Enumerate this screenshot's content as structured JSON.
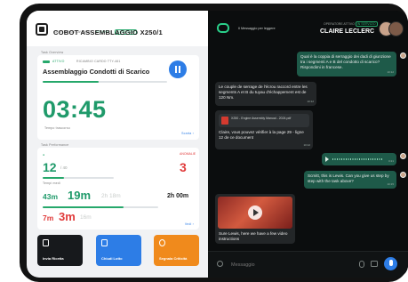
{
  "left": {
    "header": {
      "station_label": "CENTRO DI LAVORO",
      "station_status": "ATTIVO",
      "station_badge": "IN SERVIZIO",
      "title": "COBOT ASSEMBLAGGIO X250/1"
    },
    "task": {
      "section_label": "Task Overview",
      "status": "ATTIVO",
      "code": "RICAMBIO CARDO TTY-461",
      "name": "Assemblaggio Condotti di Scarico",
      "timer": "03:45",
      "timer_caption": "Tempo trascorso",
      "progress": 0.45,
      "footer_link": "Scarta ›"
    },
    "performance": {
      "section_label": "Task Performance",
      "count_value": "12",
      "count_target": "/ 40",
      "count_caption": "Pezzi completati",
      "alert_label": "ANOMALIE",
      "alert_value": "3",
      "times_caption": "Tempi medi",
      "t_min": "43m",
      "t_main": "19m",
      "t_ghost": "2h 18m",
      "t_right": "2h 00m",
      "t_bottom_small": "7m",
      "t_bottom_main": "3m",
      "t_bottom_ghost": "16m",
      "footer_link": "Vedi ›"
    },
    "actions": [
      {
        "label": "Invia Ricetta",
        "color": "#17191c"
      },
      {
        "label": "Chiudi Lotto",
        "color": "#2d7de6"
      },
      {
        "label": "Segnala Criticità",
        "color": "#f08a1c"
      }
    ]
  },
  "right": {
    "header": {
      "mode_label": "Il Messaggio per leggere",
      "status_line": "OPERATORE ATTIVO",
      "status_badge": "IN SERVIZIO",
      "name": "CLAIRE LECLERC"
    },
    "messages": [
      {
        "dir": "out",
        "text": "Qual è la coppia di serraggio dei dadi di giunzione tra i segmenti A e B del condotto di scarico? Rispondimi in francese.",
        "time": "10:12"
      },
      {
        "dir": "in",
        "text": "Le couple de serrage de l'écrou raccord entre les segments A et B du tuyau d'échappement est de 120 Nm.",
        "time": "10:12"
      },
      {
        "dir": "in",
        "attach_title": "X250 - Engine Assembly Manual - 2024.pdf",
        "text": "Claire, vous pouvez vérifier à la page 29 - ligne 12 de ce document",
        "time": "10:12"
      },
      {
        "dir": "out",
        "kind": "voice",
        "duration": "0:21",
        "time": "10:14"
      },
      {
        "dir": "out",
        "text": "Scmitt, this is Lewis. Can you give us step by step with the task above?",
        "time": "10:15"
      },
      {
        "dir": "in",
        "kind": "video",
        "text": "Sure Lewis, here we have a few video instructions",
        "time": "10:16"
      }
    ],
    "composer": {
      "placeholder": "Messaggio"
    }
  }
}
